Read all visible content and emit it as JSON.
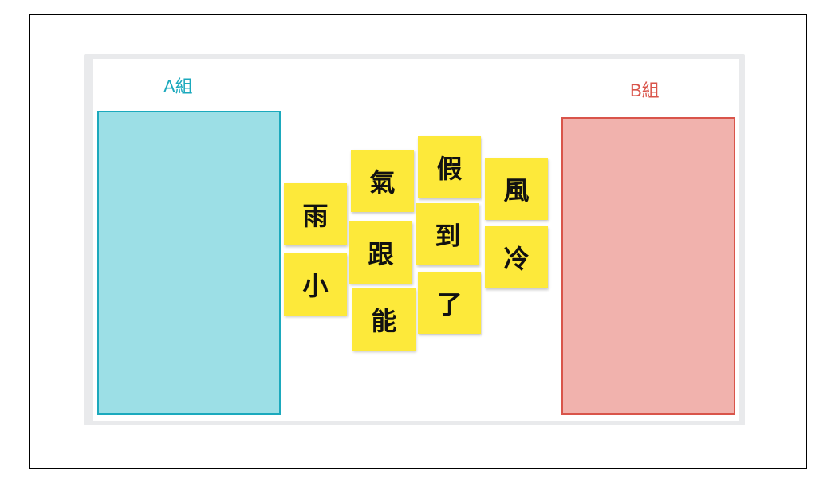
{
  "groups": {
    "a": {
      "label": "A組",
      "color": "#1ba9bd",
      "fill": "#9cdfe6"
    },
    "b": {
      "label": "B組",
      "color": "#d9544a",
      "fill": "#f1b2ad"
    }
  },
  "cards": [
    {
      "char": "雨"
    },
    {
      "char": "小"
    },
    {
      "char": "氣"
    },
    {
      "char": "跟"
    },
    {
      "char": "能"
    },
    {
      "char": "假"
    },
    {
      "char": "到"
    },
    {
      "char": "了"
    },
    {
      "char": "風"
    },
    {
      "char": "冷"
    }
  ],
  "card_color": "#fde93a"
}
